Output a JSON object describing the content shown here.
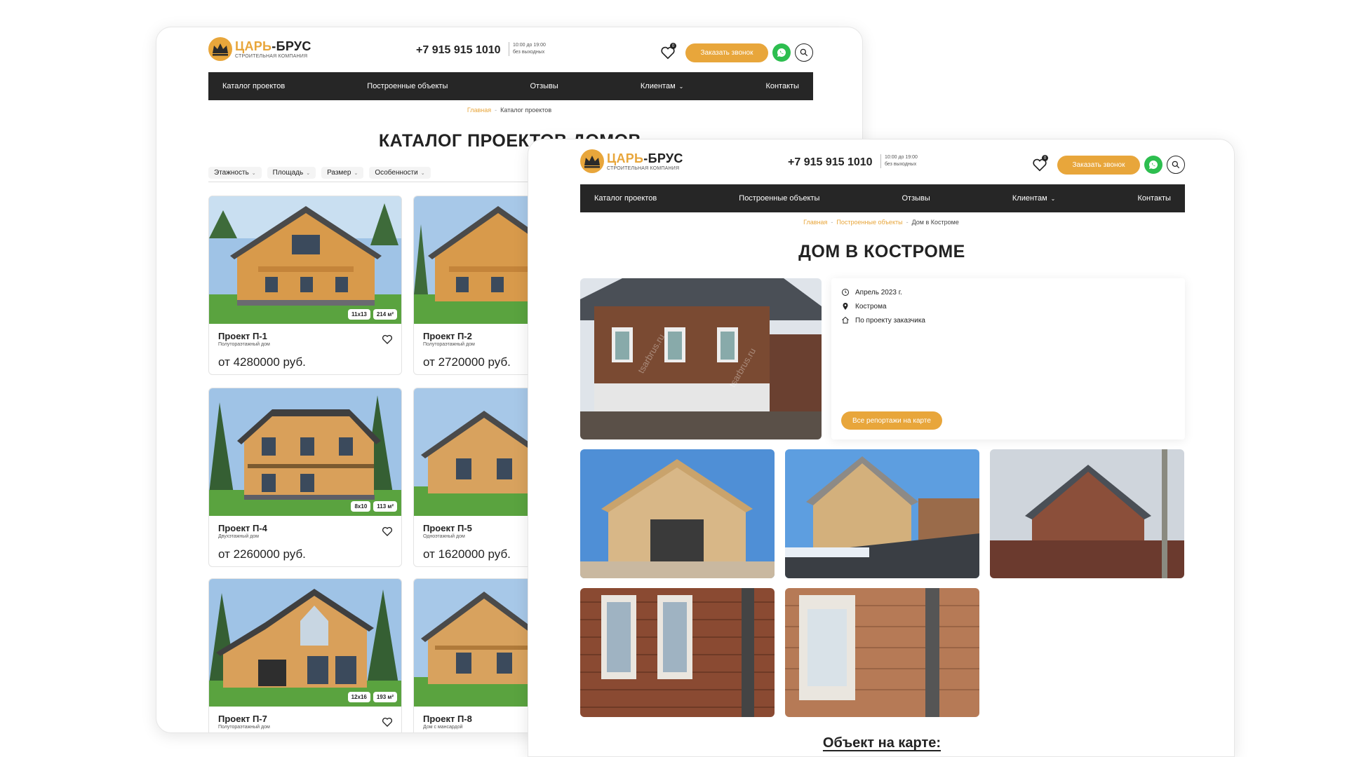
{
  "brand": {
    "name_accent": "ЦАРЬ",
    "name_rest": "-БРУС",
    "tagline": "СТРОИТЕЛЬНАЯ КОМПАНИЯ",
    "accent_color": "#e8a63b",
    "nav_color": "#262626"
  },
  "header": {
    "phone": "+7 915 915 1010",
    "hours_line1": "10:00 до 19:00",
    "hours_line2": "без выходных",
    "favorites_count": "0",
    "call_button": "Заказать звонок"
  },
  "nav": {
    "items": [
      "Каталог проектов",
      "Построенные объекты",
      "Отзывы",
      "Клиентам",
      "Контакты"
    ]
  },
  "catalog_page": {
    "breadcrumb": {
      "home": "Главная",
      "sep": "-",
      "current": "Каталог проектов"
    },
    "title": "КАТАЛОГ ПРОЕКТОВ ДОМОВ",
    "filters": [
      "Этажность",
      "Площадь",
      "Размер",
      "Особенности"
    ],
    "cards": [
      {
        "name": "Проект П-1",
        "type": "Полутораэтажный дом",
        "price": "от 4280000 руб.",
        "size": "11x13",
        "area": "214 м²"
      },
      {
        "name": "Проект П-2",
        "type": "Полутораэтажный дом",
        "price": "от 2720000 руб.",
        "size": "",
        "area": ""
      },
      {
        "name": "Проект П-4",
        "type": "Двухэтажный дом",
        "price": "от 2260000 руб.",
        "size": "8x10",
        "area": "113 м²"
      },
      {
        "name": "Проект П-5",
        "type": "Одноэтажный дом",
        "price": "от 1620000 руб.",
        "size": "",
        "area": ""
      },
      {
        "name": "Проект П-7",
        "type": "Полутораэтажный дом",
        "price": "",
        "size": "12x16",
        "area": "193 м²"
      },
      {
        "name": "Проект П-8",
        "type": "Дом с мансардой",
        "price": "",
        "size": "",
        "area": ""
      }
    ]
  },
  "object_page": {
    "breadcrumb": {
      "home": "Главная",
      "sep": "-",
      "section": "Построенные объекты",
      "current": "Дом в Костроме"
    },
    "title": "ДОМ В КОСТРОМЕ",
    "date": "Апрель 2023 г.",
    "city": "Кострома",
    "project": "По проекту заказчика",
    "map_button": "Все репортажи на карте",
    "map_heading": "Объект на карте:",
    "watermark": "tsarbrus.ru"
  }
}
